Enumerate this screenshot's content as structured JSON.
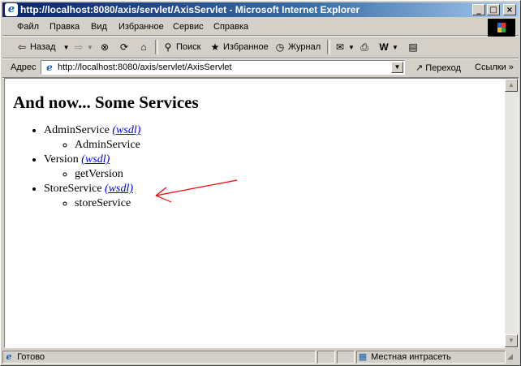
{
  "window": {
    "title": "http://localhost:8080/axis/servlet/AxisServlet - Microsoft Internet Explorer"
  },
  "menu": [
    {
      "label": "Файл"
    },
    {
      "label": "Правка"
    },
    {
      "label": "Вид"
    },
    {
      "label": "Избранное"
    },
    {
      "label": "Сервис"
    },
    {
      "label": "Справка"
    }
  ],
  "toolbar": {
    "back_label": "Назад",
    "search_label": "Поиск",
    "favorites_label": "Избранное",
    "history_label": "Журнал"
  },
  "address": {
    "label": "Адрес",
    "url": "http://localhost:8080/axis/servlet/AxisServlet",
    "go_label": "Переход",
    "links_label": "Ссылки"
  },
  "page": {
    "heading": "And now... Some Services",
    "wsdl_label": "(wsdl)",
    "services": [
      {
        "name": "AdminService",
        "operations": [
          "AdminService"
        ]
      },
      {
        "name": "Version",
        "operations": [
          "getVersion"
        ]
      },
      {
        "name": "StoreService",
        "operations": [
          "storeService"
        ]
      }
    ]
  },
  "status": {
    "text": "Готово",
    "zone": "Местная интрасеть"
  },
  "colors": {
    "annotation_arrow": "#ff0000",
    "link": "#0000ee"
  }
}
